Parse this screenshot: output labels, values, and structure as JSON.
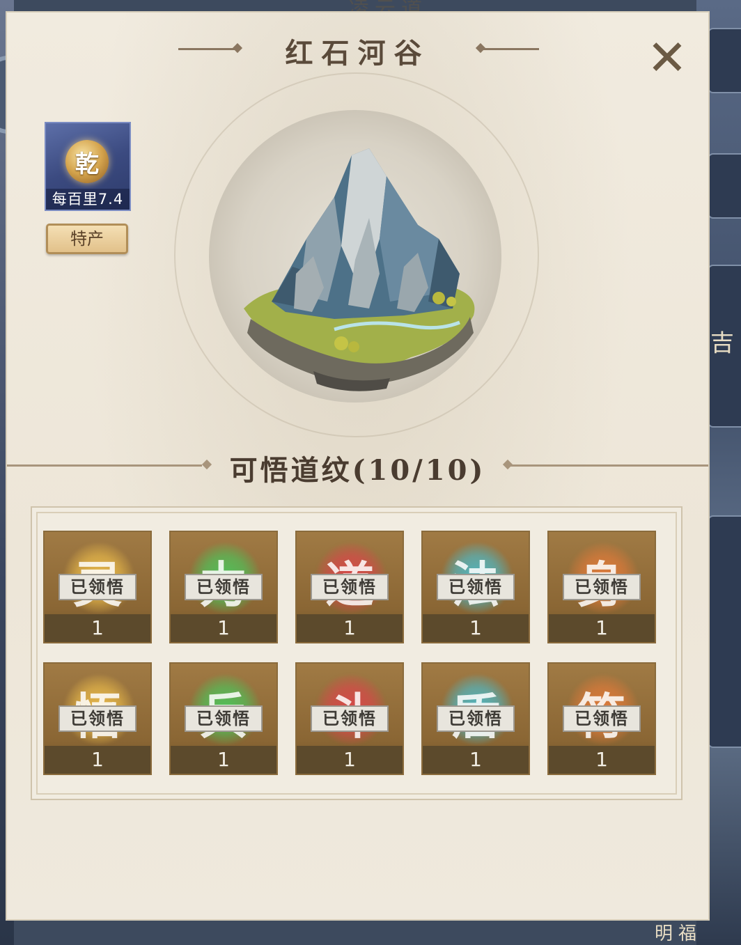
{
  "background": {
    "top_text": "凌云道",
    "right_char": "吉",
    "bottom_right_text": "明福"
  },
  "panel": {
    "title": "红石河谷",
    "close_icon": "close-icon"
  },
  "resource": {
    "coin_char": "乾",
    "label": "每百里7.4",
    "special_button": "特产"
  },
  "section": {
    "title": "可悟道纹(10/10)"
  },
  "cards": [
    {
      "glyph": "灵",
      "tag": "已领悟",
      "count": "1",
      "color": "#e8b94a"
    },
    {
      "glyph": "力",
      "tag": "已领悟",
      "count": "1",
      "color": "#4fc25a"
    },
    {
      "glyph": "道",
      "tag": "已领悟",
      "count": "1",
      "color": "#d8484a"
    },
    {
      "glyph": "法",
      "tag": "已领悟",
      "count": "1",
      "color": "#4fb8c4"
    },
    {
      "glyph": "身",
      "tag": "已领悟",
      "count": "1",
      "color": "#de7a3a"
    },
    {
      "glyph": "悟",
      "tag": "已领悟",
      "count": "1",
      "color": "#e8b94a"
    },
    {
      "glyph": "兵",
      "tag": "已领悟",
      "count": "1",
      "color": "#4fc25a"
    },
    {
      "glyph": "斗",
      "tag": "已领悟",
      "count": "1",
      "color": "#d8484a"
    },
    {
      "glyph": "盾",
      "tag": "已领悟",
      "count": "1",
      "color": "#4fb8c4"
    },
    {
      "glyph": "符",
      "tag": "已领悟",
      "count": "1",
      "color": "#de7a3a"
    }
  ]
}
